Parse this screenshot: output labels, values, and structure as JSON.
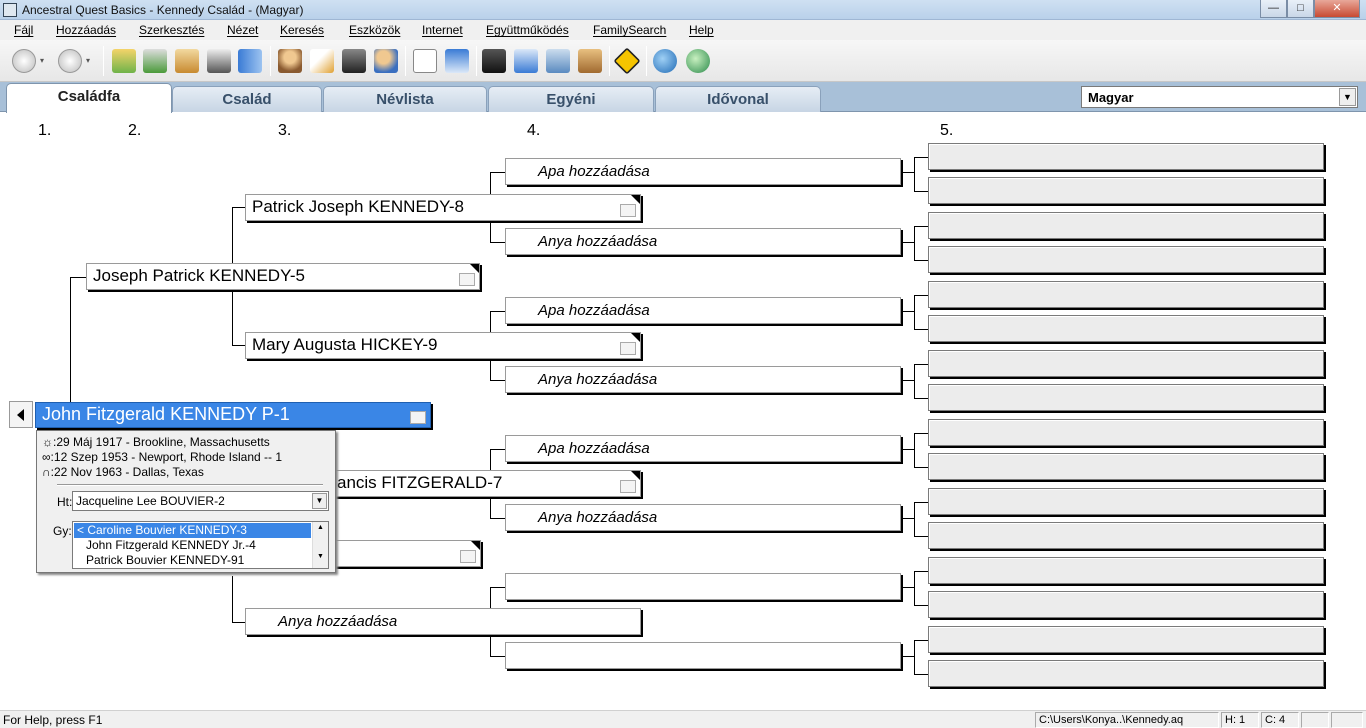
{
  "window": {
    "title": "Ancestral Quest Basics - Kennedy Család - (Magyar)",
    "minimize": "—",
    "maximize": "□",
    "close": "✕"
  },
  "menu": [
    "Fájl",
    "Hozzáadás",
    "Szerkesztés",
    "Nézet",
    "Keresés",
    "Eszközök",
    "Internet",
    "Együttműködés",
    "FamilySearch",
    "Help"
  ],
  "toolbar_icons": [
    "back-icon",
    "forward-icon",
    "open-icon",
    "import-icon",
    "export-icon",
    "print-icon",
    "book-icon",
    "individual-icon",
    "edit-icon",
    "camera-icon",
    "add-person-icon",
    "notes-icon",
    "calendar-icon",
    "search-icon",
    "report-icon",
    "tree-chart-icon",
    "home-icon",
    "warning-icon",
    "internet-icon",
    "web-search-icon"
  ],
  "tabs": [
    "Családfa",
    "Család",
    "Névlista",
    "Egyéni",
    "Idővonal"
  ],
  "active_tab": "Családfa",
  "language": "Magyar",
  "generations": [
    "1.",
    "2.",
    "3.",
    "4.",
    "5."
  ],
  "pedigree": {
    "p1": "John Fitzgerald KENNEDY P-1",
    "p2_father": "Joseph Patrick KENNEDY-5",
    "p3_ff": "Patrick Joseph KENNEDY-8",
    "p3_fm": "Mary Augusta HICKEY-9",
    "p3_mf_partial": "ancis FITZGERALD-7",
    "p3_mm": "Anya hozzáadása",
    "add_father": "Apa hozzáadása",
    "add_mother": "Anya hozzáadása"
  },
  "popup": {
    "birth": "☼:29 Máj 1917 - Brookline, Massachusetts",
    "marriage": "∞:12 Szep 1953 - Newport, Rhode Island -- 1",
    "death": "∩:22 Nov 1963 - Dallas, Texas",
    "spouse_label": "Ht:",
    "spouse": "Jacqueline Lee BOUVIER-2",
    "children_label": "Gy:",
    "children": [
      "< Caroline Bouvier KENNEDY-3",
      "John Fitzgerald KENNEDY Jr.-4",
      "Patrick Bouvier KENNEDY-91"
    ]
  },
  "status": {
    "help": "For Help, press F1",
    "path": "C:\\Users\\Konya..\\Kennedy.aq",
    "h": "H: 1",
    "c": "C: 4"
  },
  "colors": {
    "selected": "#3a86e6",
    "tabbar": "#a8c0d8"
  }
}
